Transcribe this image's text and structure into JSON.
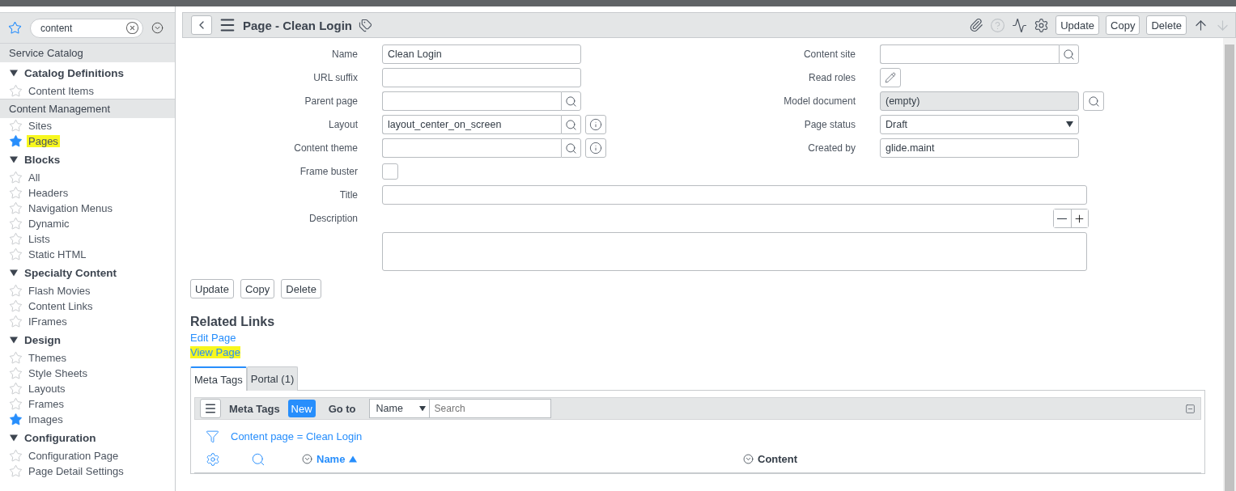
{
  "nav": {
    "filter": "content",
    "entries": [
      {
        "kind": "section",
        "label": "Service Catalog"
      },
      {
        "kind": "group",
        "label": "Catalog Definitions",
        "expanded": true
      },
      {
        "kind": "item",
        "label": "Content Items",
        "favorite": false,
        "highlighted": false
      },
      {
        "kind": "section",
        "label": "Content Management"
      },
      {
        "kind": "item",
        "label": "Sites",
        "favorite": false,
        "highlighted": false
      },
      {
        "kind": "item",
        "label": "Pages",
        "favorite": true,
        "highlighted": true
      },
      {
        "kind": "group",
        "label": "Blocks",
        "expanded": true
      },
      {
        "kind": "item",
        "label": "All",
        "favorite": false,
        "highlighted": false
      },
      {
        "kind": "item",
        "label": "Headers",
        "favorite": false,
        "highlighted": false
      },
      {
        "kind": "item",
        "label": "Navigation Menus",
        "favorite": false,
        "highlighted": false
      },
      {
        "kind": "item",
        "label": "Dynamic",
        "favorite": false,
        "highlighted": false
      },
      {
        "kind": "item",
        "label": "Lists",
        "favorite": false,
        "highlighted": false
      },
      {
        "kind": "item",
        "label": "Static HTML",
        "favorite": false,
        "highlighted": false
      },
      {
        "kind": "group",
        "label": "Specialty Content",
        "expanded": true
      },
      {
        "kind": "item",
        "label": "Flash Movies",
        "favorite": false,
        "highlighted": false
      },
      {
        "kind": "item",
        "label": "Content Links",
        "favorite": false,
        "highlighted": false
      },
      {
        "kind": "item",
        "label": "IFrames",
        "favorite": false,
        "highlighted": false
      },
      {
        "kind": "group",
        "label": "Design",
        "expanded": true
      },
      {
        "kind": "item",
        "label": "Themes",
        "favorite": false,
        "highlighted": false
      },
      {
        "kind": "item",
        "label": "Style Sheets",
        "favorite": false,
        "highlighted": false
      },
      {
        "kind": "item",
        "label": "Layouts",
        "favorite": false,
        "highlighted": false
      },
      {
        "kind": "item",
        "label": "Frames",
        "favorite": false,
        "highlighted": false
      },
      {
        "kind": "item",
        "label": "Images",
        "favorite": true,
        "highlighted": false
      },
      {
        "kind": "group",
        "label": "Configuration",
        "expanded": true
      },
      {
        "kind": "item",
        "label": "Configuration Page",
        "favorite": false,
        "highlighted": false
      },
      {
        "kind": "item",
        "label": "Page Detail Settings",
        "favorite": false,
        "highlighted": false
      }
    ]
  },
  "header": {
    "title": "Page - Clean Login",
    "buttons": [
      "Update",
      "Copy",
      "Delete"
    ]
  },
  "form": {
    "left_fields": [
      {
        "label": "Name",
        "kind": "text",
        "value": "Clean Login"
      },
      {
        "label": "URL suffix",
        "kind": "text"
      },
      {
        "label": "Parent page",
        "kind": "reference",
        "info": false
      },
      {
        "label": "Layout",
        "kind": "reference",
        "value": "layout_center_on_screen",
        "info": true
      },
      {
        "label": "Content theme",
        "kind": "reference",
        "info": true
      },
      {
        "label": "Frame buster",
        "kind": "checkbox",
        "checked": false
      }
    ],
    "right_fields": [
      {
        "label": "Content site",
        "kind": "reference"
      },
      {
        "label": "Read roles",
        "kind": "edit"
      },
      {
        "label": "Model document",
        "kind": "readonly",
        "value": "(empty)"
      },
      {
        "label": "Page status",
        "kind": "select",
        "value": "Draft"
      },
      {
        "label": "Created by",
        "kind": "text",
        "value": "glide.maint"
      }
    ],
    "title_label": "Title",
    "description_label": "Description",
    "buttons": [
      "Update",
      "Copy",
      "Delete"
    ]
  },
  "related_links": {
    "title": "Related Links",
    "links": [
      {
        "label": "Edit Page",
        "highlighted": false
      },
      {
        "label": "View Page",
        "highlighted": true
      }
    ]
  },
  "tabs": [
    {
      "label": "Meta Tags",
      "selected": true
    },
    {
      "label": "Portal (1)",
      "selected": false
    }
  ],
  "list": {
    "title": "Meta Tags",
    "new_button": "New",
    "goto_label": "Go to",
    "goto_field": "Name",
    "search_placeholder": "Search",
    "filter": "Content page = Clean Login",
    "columns": [
      {
        "label": "Name",
        "sorted": true
      },
      {
        "label": "Content",
        "sorted": false
      }
    ]
  }
}
